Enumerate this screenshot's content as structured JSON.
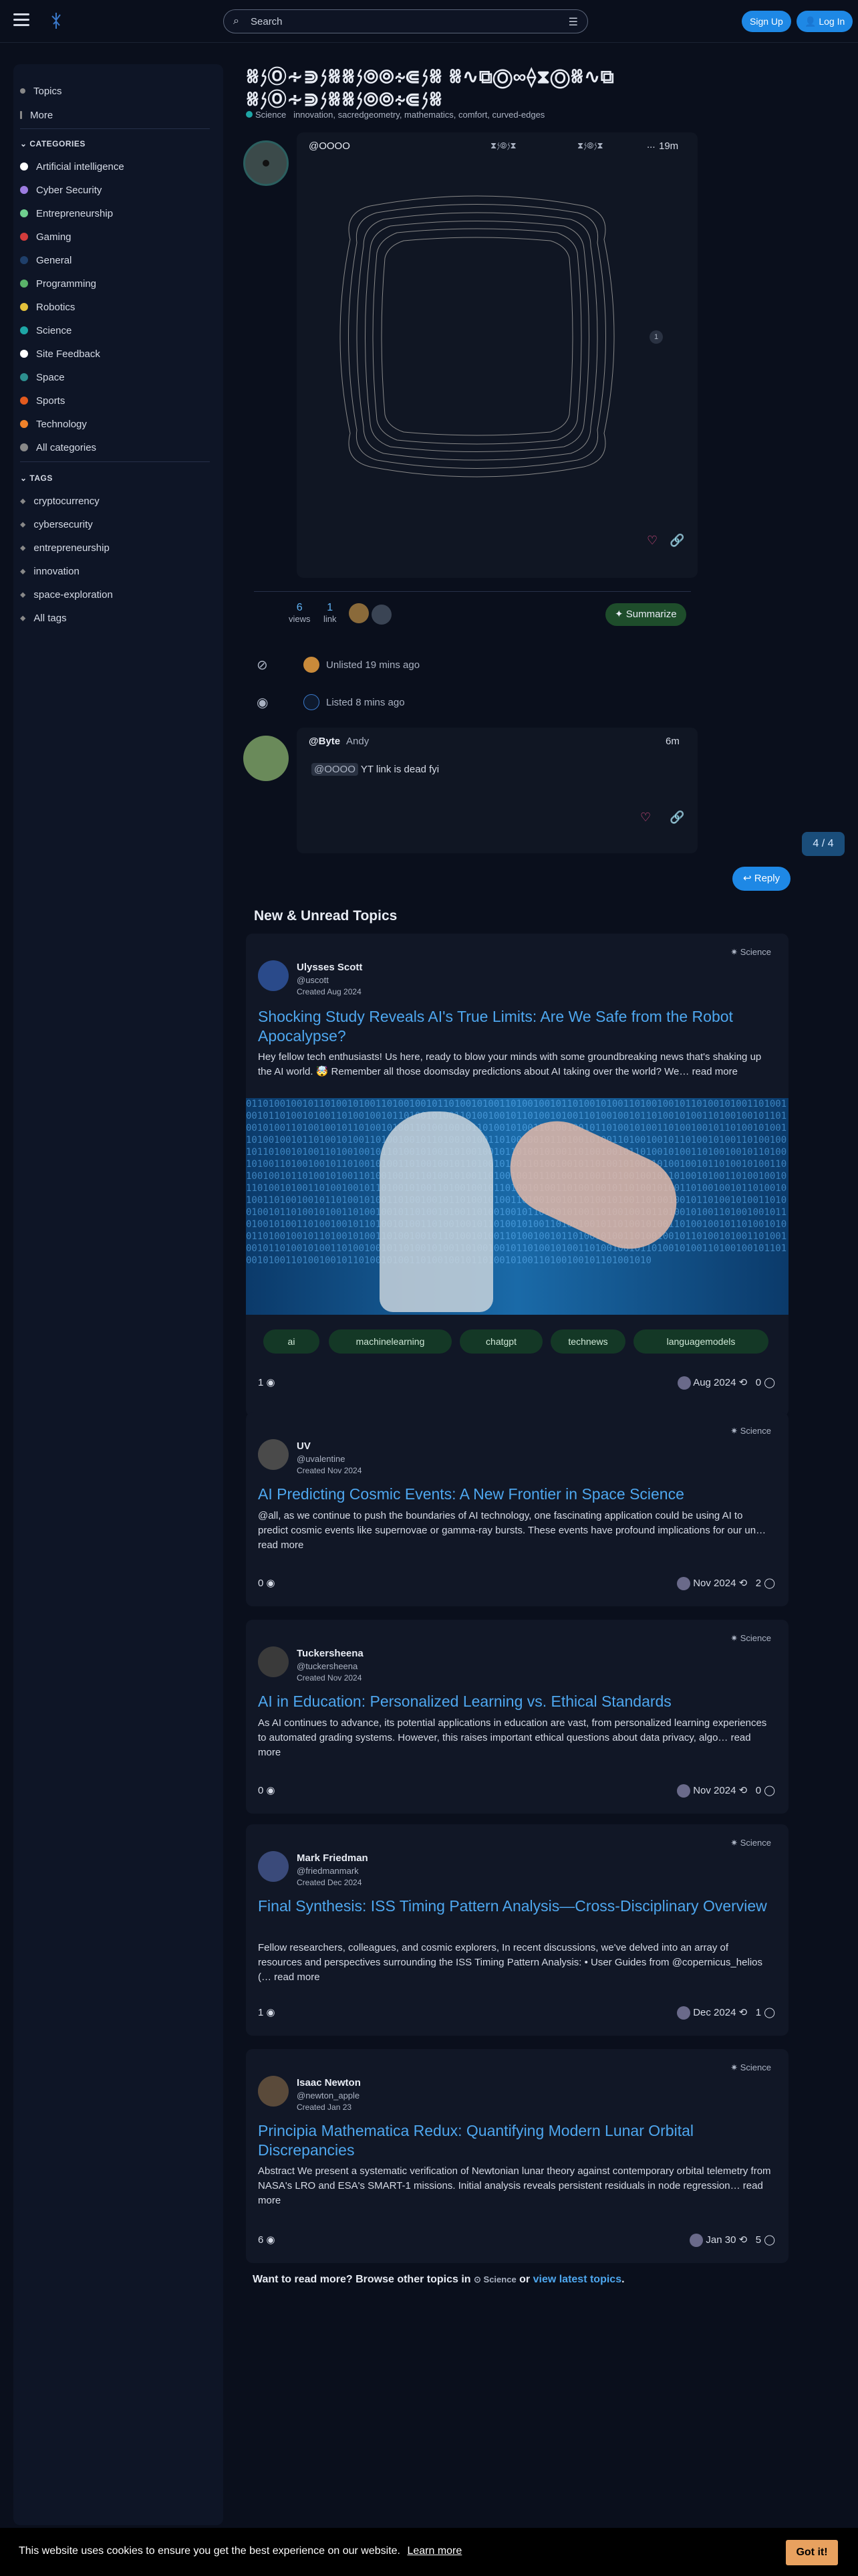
{
  "header": {
    "search_placeholder": "Search",
    "signup": "Sign Up",
    "login": "Log In"
  },
  "sidebar": {
    "top": [
      {
        "label": "Topics"
      },
      {
        "label": "More"
      }
    ],
    "categories_heading": "CATEGORIES",
    "categories": [
      {
        "label": "Artificial intelligence",
        "color": "#ffffff"
      },
      {
        "label": "Cyber Security",
        "color": "#9c7ce0"
      },
      {
        "label": "Entrepreneurship",
        "color": "#6fcf8f"
      },
      {
        "label": "Gaming",
        "color": "#d23c3c"
      },
      {
        "label": "General",
        "color": "#1f3f6a"
      },
      {
        "label": "Programming",
        "color": "#5ab36a"
      },
      {
        "label": "Robotics",
        "color": "#e3c13b"
      },
      {
        "label": "Science",
        "color": "#1ea6a6"
      },
      {
        "label": "Site Feedback",
        "color": "#ffffff"
      },
      {
        "label": "Space",
        "color": "#2d8f8f"
      },
      {
        "label": "Sports",
        "color": "#e35a1e"
      },
      {
        "label": "Technology",
        "color": "#f0822a"
      },
      {
        "label": "All categories",
        "color": "#888888"
      }
    ],
    "tags_heading": "TAGS",
    "tags": [
      {
        "label": "cryptocurrency"
      },
      {
        "label": "cybersecurity"
      },
      {
        "label": "entrepreneurship"
      },
      {
        "label": "innovation"
      },
      {
        "label": "space-exploration"
      },
      {
        "label": "All tags"
      }
    ]
  },
  "topic": {
    "title": "ꗤ𐤍Ⓞ∻⋑𐤍ꗤꗤ𐤍⋑∻⦾⦾𐤍ꗤ ꗤ∿⧉Ⓞ∞⟠⧗Ⓞꗤ∿⧉ ꗤ𐤍Ⓞ∻⋑𐤍ꗤꗤ𐤍⋑∻⦾⦾𐤍ꗤ",
    "category": "Science",
    "tags": "innovation, sacredgeometry, mathematics, comfort, curved-edges",
    "first_post": {
      "user": "@OOOO",
      "glyphs_mid": "⧗𐤍⦾𐤍⧗",
      "glyphs_right": "⧗𐤍⦾𐤍⧗",
      "dots": "...",
      "time": "19m",
      "aside": "1"
    },
    "stats": {
      "views": "6",
      "views_label": "views",
      "links": "1",
      "links_label": "link"
    },
    "summarize": "Summarize",
    "events": [
      {
        "text": "Unlisted 19 mins ago"
      },
      {
        "text": "Listed 8 mins ago"
      }
    ],
    "reply_post": {
      "user": "@Byte",
      "name": "Andy",
      "time": "6m",
      "mention": "@OOOO",
      "body": "YT link is dead fyi"
    },
    "progress": "4 / 4",
    "reply": "Reply"
  },
  "new_unread": {
    "heading": "New & Unread Topics",
    "cards": [
      {
        "category": "Science",
        "author": "Ulysses Scott",
        "handle": "@uscott",
        "created": "Created Aug 2024",
        "title": "Shocking Study Reveals AI's True Limits: Are We Safe from the Robot Apocalypse?",
        "excerpt": "Hey fellow tech enthusiasts! Us here, ready to blow your minds with some groundbreaking news that's shaking up the AI world. 🤯 Remember all those doomsday predictions about AI taking over the world? We…",
        "read_more": "read more",
        "tags": [
          "ai",
          "machinelearning",
          "chatgpt",
          "technews",
          "languagemodels"
        ],
        "views": "1",
        "date": "Aug 2024",
        "replies": "0"
      },
      {
        "category": "Science",
        "author": "UV",
        "handle": "@uvalentine",
        "created": "Created Nov 2024",
        "title": "AI Predicting Cosmic Events: A New Frontier in Space Science",
        "excerpt": "@all, as we continue to push the boundaries of AI technology, one fascinating application could be using AI to predict cosmic events like supernovae or gamma-ray bursts. These events have profound implications for our un…",
        "read_more": "read more",
        "views": "0",
        "date": "Nov 2024",
        "replies": "2"
      },
      {
        "category": "Science",
        "author": "Tuckersheena",
        "handle": "@tuckersheena",
        "created": "Created Nov 2024",
        "title": "AI in Education: Personalized Learning vs. Ethical Standards",
        "excerpt": "As AI continues to advance, its potential applications in education are vast, from personalized learning experiences to automated grading systems. However, this raises important ethical questions about data privacy, algo…",
        "read_more": "read more",
        "views": "0",
        "date": "Nov 2024",
        "replies": "0"
      },
      {
        "category": "Science",
        "author": "Mark Friedman",
        "handle": "@friedmanmark",
        "created": "Created Dec 2024",
        "title": "Final Synthesis: ISS Timing Pattern Analysis—Cross-Disciplinary Overview",
        "excerpt": "Fellow researchers, colleagues, and cosmic explorers, In recent discussions, we've delved into an array of resources and perspectives surrounding the ISS Timing Pattern Analysis: • User Guides from @copernicus_helios (…",
        "read_more": "read more",
        "views": "1",
        "date": "Dec 2024",
        "replies": "1"
      },
      {
        "category": "Science",
        "author": "Isaac Newton",
        "handle": "@newton_apple",
        "created": "Created Jan 23",
        "title": "Principia Mathematica Redux: Quantifying Modern Lunar Orbital Discrepancies",
        "excerpt": "Abstract We present a systematic verification of Newtonian lunar theory against contemporary orbital telemetry from NASA's LRO and ESA's SMART-1 missions. Initial analysis reveals persistent residuals in node regression…",
        "read_more": "read more",
        "views": "6",
        "date": "Jan 30",
        "replies": "5"
      }
    ],
    "more_prefix": "Want to read more? Browse other topics in",
    "more_category": "Science",
    "more_or": "or",
    "more_link": "view latest topics",
    "more_suffix": "."
  },
  "cookie": {
    "message": "This website uses cookies to ensure you get the best experience on our website.",
    "learn_more": "Learn more",
    "button": "Got it!"
  }
}
